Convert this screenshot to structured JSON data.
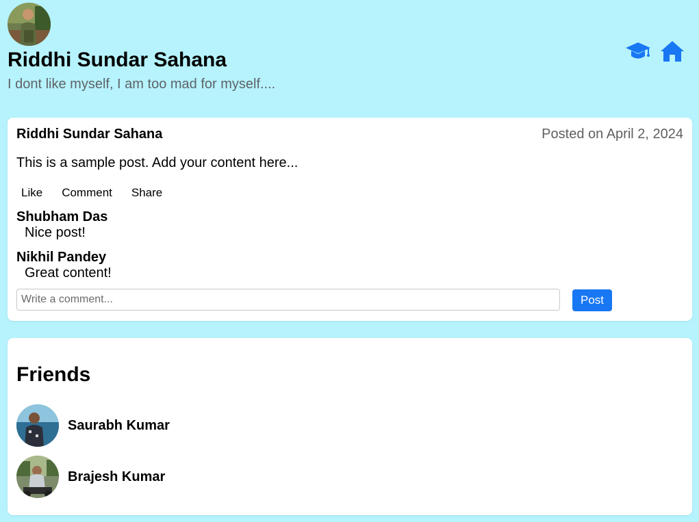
{
  "profile": {
    "name": "Riddhi Sundar Sahana",
    "bio": "I dont like myself, I am too mad for myself...."
  },
  "nav_icons": [
    "graduation-cap-icon",
    "home-icon"
  ],
  "accent_color": "#1877f2",
  "post": {
    "author": "Riddhi Sundar Sahana",
    "date": "Posted on April 2, 2024",
    "content": "This is a sample post. Add your content here...",
    "actions": {
      "like": "Like",
      "comment": "Comment",
      "share": "Share"
    },
    "comments": [
      {
        "author": "Shubham Das",
        "text": "Nice post!"
      },
      {
        "author": "Nikhil Pandey",
        "text": "Great content!"
      }
    ],
    "comment_input": {
      "placeholder": "Write a comment...",
      "value": ""
    },
    "post_button": "Post"
  },
  "friends": {
    "title": "Friends",
    "list": [
      {
        "name": "Saurabh Kumar"
      },
      {
        "name": "Brajesh Kumar"
      }
    ]
  }
}
